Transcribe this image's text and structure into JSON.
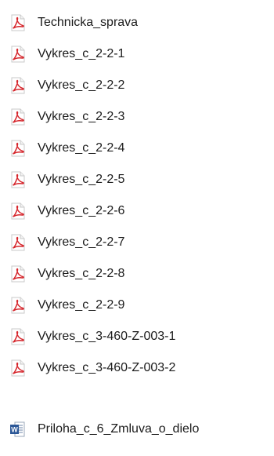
{
  "files": [
    {
      "name": "Technicka_sprava",
      "icon": "pdf-icon"
    },
    {
      "name": "Vykres_c_2-2-1",
      "icon": "pdf-icon"
    },
    {
      "name": "Vykres_c_2-2-2",
      "icon": "pdf-icon"
    },
    {
      "name": "Vykres_c_2-2-3",
      "icon": "pdf-icon"
    },
    {
      "name": "Vykres_c_2-2-4",
      "icon": "pdf-icon"
    },
    {
      "name": "Vykres_c_2-2-5",
      "icon": "pdf-icon"
    },
    {
      "name": "Vykres_c_2-2-6",
      "icon": "pdf-icon"
    },
    {
      "name": "Vykres_c_2-2-7",
      "icon": "pdf-icon"
    },
    {
      "name": "Vykres_c_2-2-8",
      "icon": "pdf-icon"
    },
    {
      "name": "Vykres_c_2-2-9",
      "icon": "pdf-icon"
    },
    {
      "name": "Vykres_c_3-460-Z-003-1",
      "icon": "pdf-icon"
    },
    {
      "name": "Vykres_c_3-460-Z-003-2",
      "icon": "pdf-icon"
    },
    {
      "name": "Priloha_c_6_Zmluva_o_dielo",
      "icon": "word-document-icon"
    }
  ],
  "colors": {
    "pdf_red": "#d6262c",
    "word_blue": "#2b5797",
    "text": "#1b1b1b",
    "background": "#ffffff"
  }
}
